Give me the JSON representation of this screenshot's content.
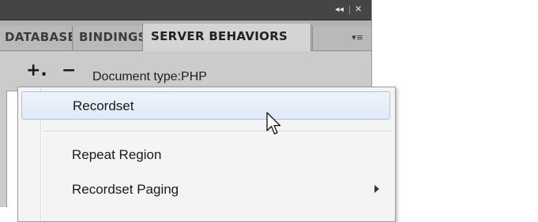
{
  "panel": {
    "titlebar": {
      "collapse_glyph": "◂◂",
      "close_glyph": "✕"
    },
    "tabs": [
      {
        "label": "DATABASES",
        "active": false
      },
      {
        "label": "BINDINGS",
        "active": false
      },
      {
        "label": "SERVER BEHAVIORS",
        "active": true
      }
    ],
    "options_glyph": "▾≡",
    "toolbar": {
      "add_label": "+.",
      "remove_label": "−",
      "document_type": "Document type:PHP"
    }
  },
  "context_menu": {
    "items": [
      {
        "label": "Recordset",
        "highlighted": true,
        "submenu": false
      },
      {
        "label": "Repeat Region",
        "highlighted": false,
        "submenu": false
      },
      {
        "label": "Recordset Paging",
        "highlighted": false,
        "submenu": true
      }
    ]
  },
  "icons": {
    "collapse": "collapse-panels-icon",
    "close": "close-icon",
    "options": "panel-options-menu-icon",
    "add": "plus-icon",
    "remove": "minus-icon",
    "submenu": "submenu-arrow-icon",
    "cursor": "mouse-pointer-icon"
  },
  "colors": {
    "titlebar": "#454545",
    "panel": "#cbcbcb",
    "menu_highlight": "#dfe9f7",
    "menu_highlight_border": "#a9c3e6"
  }
}
